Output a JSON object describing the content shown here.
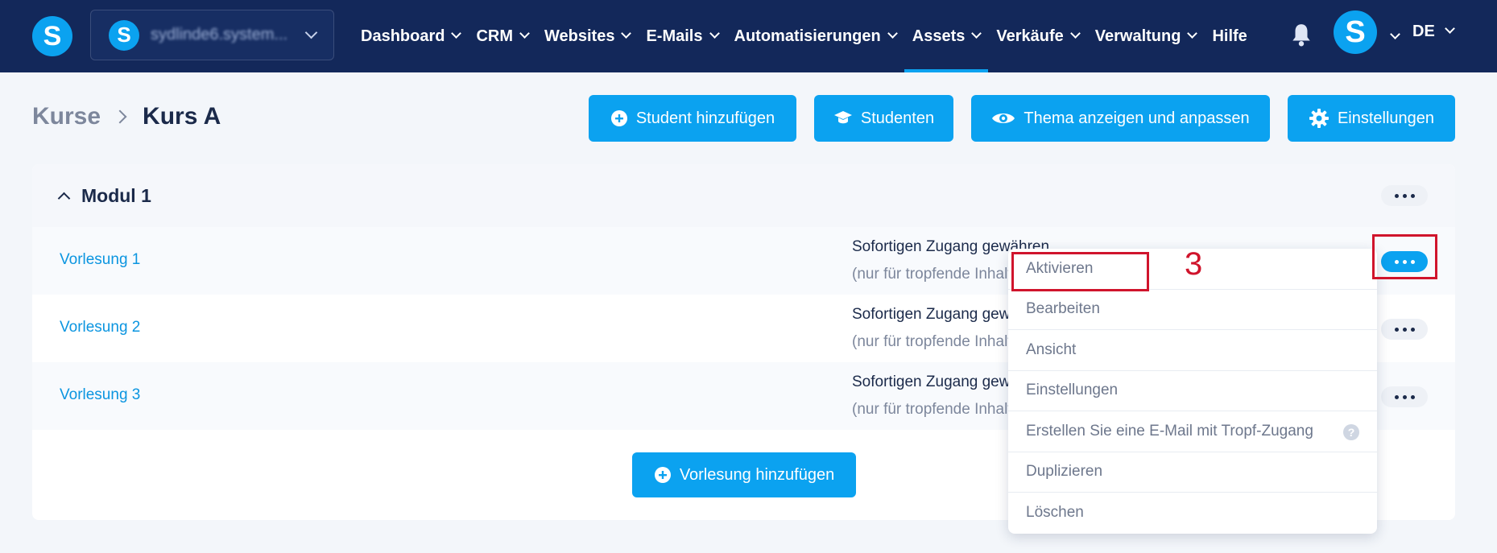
{
  "nav": {
    "logo_letter": "S",
    "account": {
      "logo_letter": "S",
      "name": "sydlinde6.system..."
    },
    "items": [
      {
        "label": "Dashboard",
        "has_chevron": true
      },
      {
        "label": "CRM",
        "has_chevron": true
      },
      {
        "label": "Websites",
        "has_chevron": true
      },
      {
        "label": "E-Mails",
        "has_chevron": true
      },
      {
        "label": "Automatisierungen",
        "has_chevron": true
      },
      {
        "label": "Assets",
        "has_chevron": true,
        "active": true
      },
      {
        "label": "Verkäufe",
        "has_chevron": true
      },
      {
        "label": "Verwaltung",
        "has_chevron": true
      },
      {
        "label": "Hilfe",
        "has_chevron": false
      }
    ],
    "avatar_letter": "S",
    "language": "DE"
  },
  "breadcrumb": {
    "parent": "Kurse",
    "current": "Kurs A"
  },
  "actions": {
    "add_student": "Student hinzufügen",
    "students": "Studenten",
    "theme": "Thema anzeigen und anpassen",
    "settings": "Einstellungen"
  },
  "module": {
    "title": "Modul 1",
    "lectures": [
      {
        "name": "Vorlesung 1",
        "access_title": "Sofortigen Zugang gewähren",
        "access_sub": "(nur für tropfende Inhalte)"
      },
      {
        "name": "Vorlesung 2",
        "access_title": "Sofortigen Zugang gewähren",
        "access_sub": "(nur für tropfende Inhalte)"
      },
      {
        "name": "Vorlesung 3",
        "access_title": "Sofortigen Zugang gewähren",
        "access_sub": "(nur für tropfende Inhalte)"
      }
    ],
    "add_lecture": "Vorlesung hinzufügen"
  },
  "dropdown": {
    "items": [
      "Aktivieren",
      "Bearbeiten",
      "Ansicht",
      "Einstellungen",
      "Erstellen Sie eine E-Mail mit Tropf-Zugang",
      "Duplizieren",
      "Löschen"
    ],
    "help_badge": "?"
  },
  "annotation": {
    "step_number": "3",
    "color": "#d0142c"
  },
  "colors": {
    "nav_bg": "#13285a",
    "accent": "#0ba2f0",
    "page_bg": "#f3f6fa"
  }
}
